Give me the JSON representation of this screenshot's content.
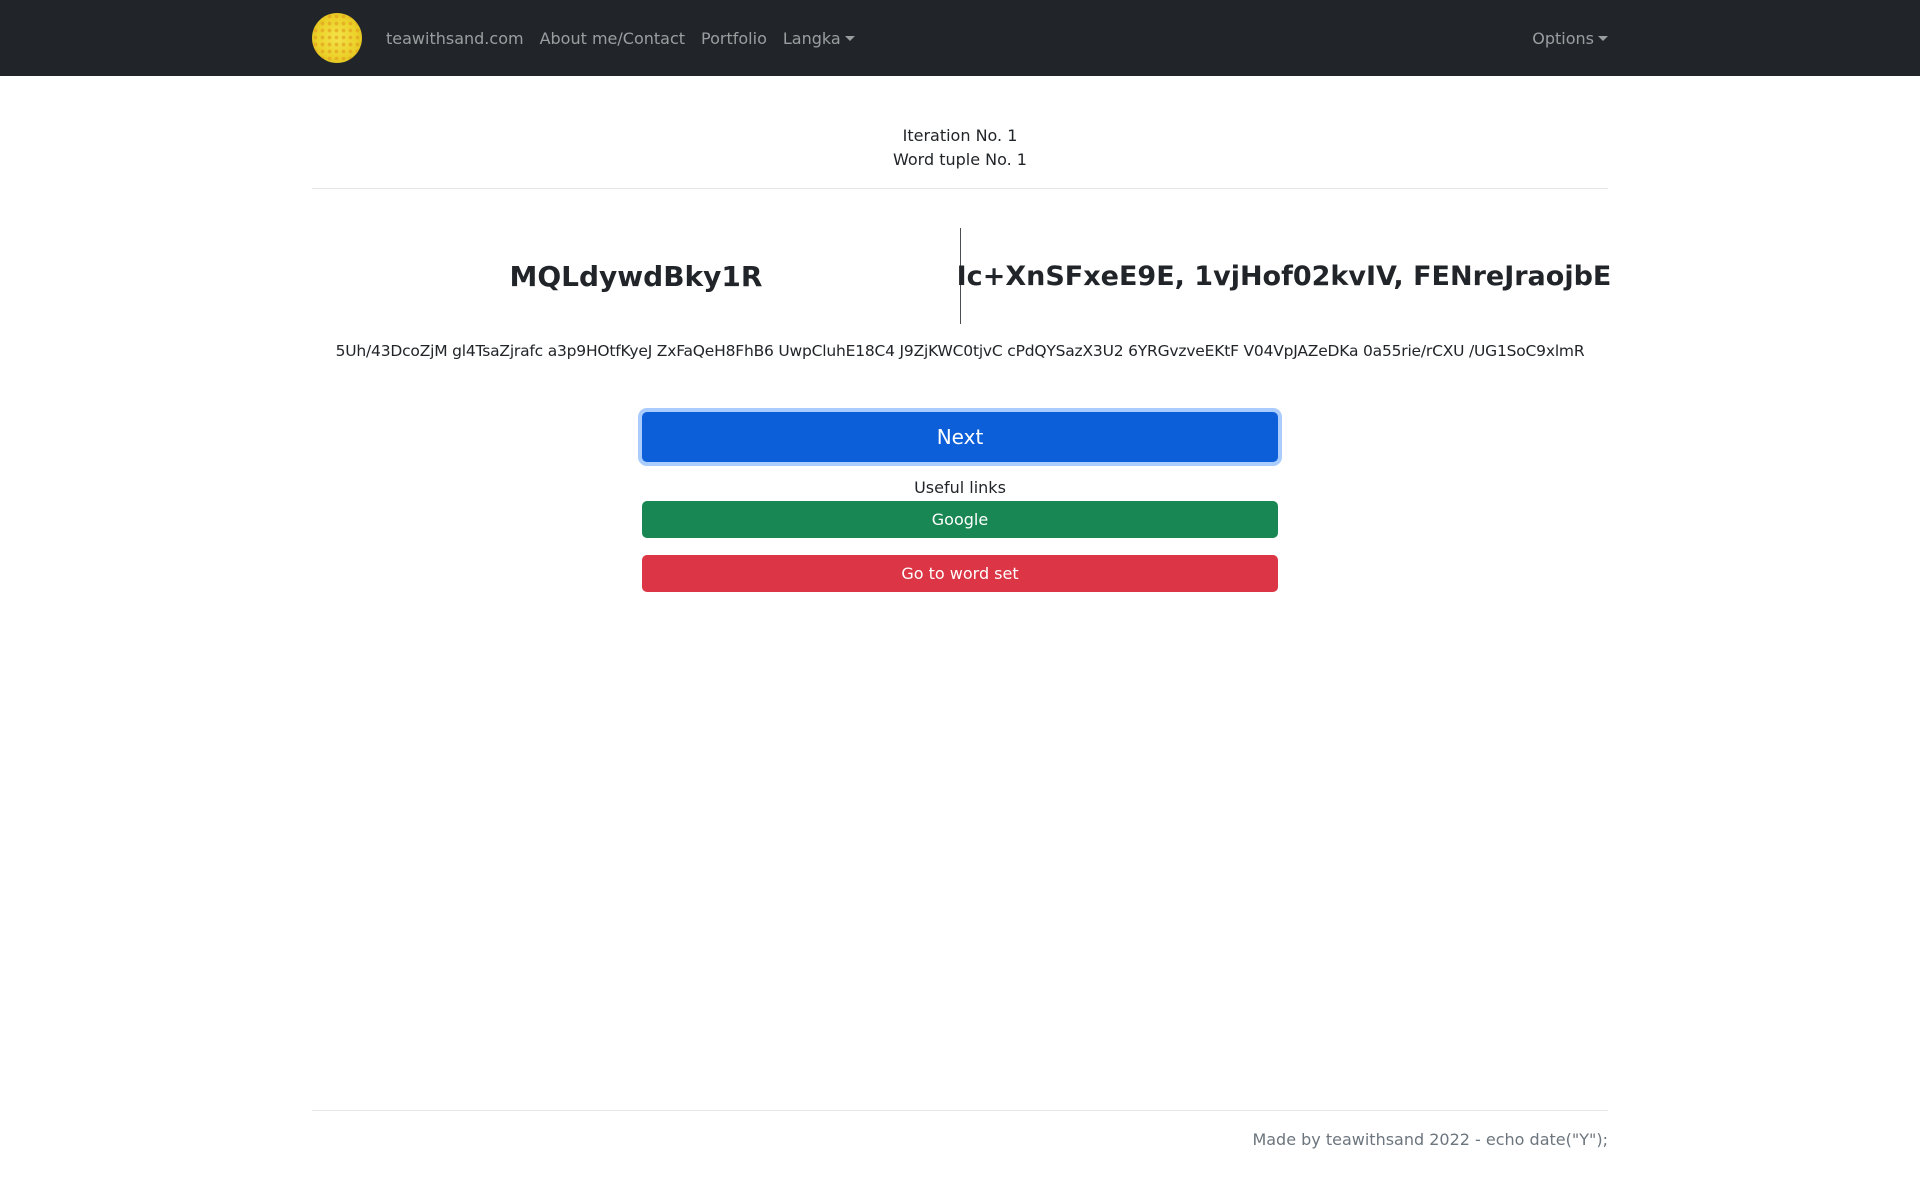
{
  "nav": {
    "brand_label": "teawithsand.com",
    "links": [
      "About me/Contact",
      "Portfolio"
    ],
    "dropdown_label": "Langka",
    "options_label": "Options",
    "logo_icon": "yellow-dotted-circle-icon"
  },
  "status": {
    "iteration": "Iteration No. 1",
    "word_tuple": "Word tuple No. 1"
  },
  "words": {
    "left": "MQLdywdBky1R",
    "right": "Ic+XnSFxeE9E, 1vjHof02kvIV, FENreJraojbE"
  },
  "sentence": "5Uh/43DcoZjM gl4TsaZjrafc a3p9HOtfKyeJ ZxFaQeH8FhB6 UwpCluhE18C4 J9ZjKWC0tjvC cPdQYSazX3U2 6YRGvzveEKtF V04VpJAZeDKa 0a55rie/rCXU /UG1SoC9xlmR",
  "actions": {
    "next_label": "Next",
    "useful_links_label": "Useful links",
    "google_label": "Google",
    "word_set_label": "Go to word set"
  },
  "footer": {
    "text": "Made by teawithsand 2022 - echo date(\"Y\");"
  },
  "colors": {
    "navbar": "#212529",
    "primary": "#0d5fd9",
    "success": "#198754",
    "danger": "#dc3545"
  }
}
